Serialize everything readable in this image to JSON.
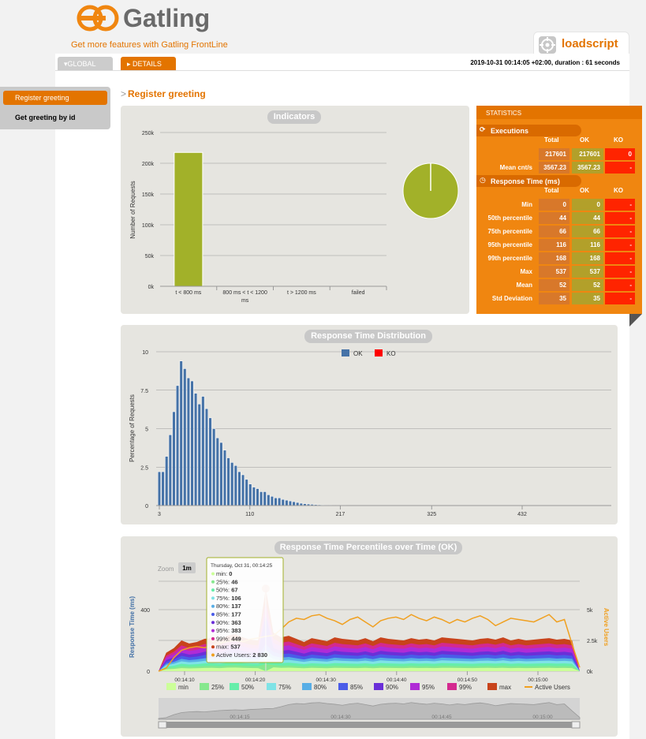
{
  "brand": {
    "name": "Gatling",
    "frontline_link": "Get more features with Gatling FrontLine"
  },
  "simulation": {
    "name": "loadscript"
  },
  "tabs": {
    "global": "GLOBAL",
    "details": "DETAILS"
  },
  "run_info": "2019-10-31 00:14:05 +02:00, duration : 61 seconds",
  "sidebar": {
    "items": [
      {
        "label": "Register greeting"
      },
      {
        "label": "Get greeting by id"
      }
    ]
  },
  "page_title": "Register greeting",
  "indicators": {
    "title": "Indicators",
    "chart_data": {
      "type": "bar",
      "categories": [
        "t < 800 ms",
        "800 ms < t < 1200 ms",
        "t > 1200 ms",
        "failed"
      ],
      "values": [
        217601,
        0,
        0,
        0
      ],
      "ylabel": "Number of Requests",
      "yticks": [
        "0k",
        "50k",
        "100k",
        "150k",
        "200k",
        "250k"
      ],
      "ylim": [
        0,
        250000
      ],
      "colors": [
        "#a2b129"
      ]
    },
    "pie": {
      "values": [
        217601,
        0
      ],
      "colors": [
        "#a2b129",
        "#ff0000"
      ]
    }
  },
  "statistics": {
    "title": "STATISTICS",
    "executions": {
      "title": "Executions",
      "headers": [
        "Total",
        "OK",
        "KO"
      ],
      "rows": [
        {
          "label": "",
          "total": "217601",
          "ok": "217601",
          "ko": "0"
        },
        {
          "label": "Mean cnt/s",
          "total": "3567.23",
          "ok": "3567.23",
          "ko": "-"
        }
      ]
    },
    "response_time": {
      "title": "Response Time (ms)",
      "headers": [
        "Total",
        "OK",
        "KO"
      ],
      "rows": [
        {
          "label": "Min",
          "total": "0",
          "ok": "0",
          "ko": "-"
        },
        {
          "label": "50th percentile",
          "total": "44",
          "ok": "44",
          "ko": "-"
        },
        {
          "label": "75th percentile",
          "total": "66",
          "ok": "66",
          "ko": "-"
        },
        {
          "label": "95th percentile",
          "total": "116",
          "ok": "116",
          "ko": "-"
        },
        {
          "label": "99th percentile",
          "total": "168",
          "ok": "168",
          "ko": "-"
        },
        {
          "label": "Max",
          "total": "537",
          "ok": "537",
          "ko": "-"
        },
        {
          "label": "Mean",
          "total": "52",
          "ok": "52",
          "ko": "-"
        },
        {
          "label": "Std Deviation",
          "total": "35",
          "ok": "35",
          "ko": "-"
        }
      ]
    }
  },
  "distribution": {
    "title": "Response Time Distribution",
    "chart_data": {
      "type": "bar",
      "ylabel": "Percentage of Requests",
      "yticks": [
        "0",
        "2.5",
        "5",
        "7.5",
        "10"
      ],
      "ylim": [
        0,
        10
      ],
      "xticks": [
        "3",
        "110",
        "217",
        "325",
        "432"
      ],
      "xlim": [
        3,
        540
      ],
      "legend": [
        {
          "name": "OK",
          "color": "#4572a7"
        },
        {
          "name": "KO",
          "color": "#ff0000"
        }
      ],
      "bin_width": 4.3,
      "x": [
        3,
        7.3,
        11.6,
        15.9,
        20.2,
        24.5,
        28.8,
        33.1,
        37.4,
        41.7,
        46,
        50.3,
        54.6,
        58.9,
        63.2,
        67.5,
        71.8,
        76.1,
        80.4,
        84.7,
        89,
        93.3,
        97.6,
        101.9,
        106.2,
        110.5,
        114.8,
        119.1,
        123.4,
        127.7,
        132,
        136.3,
        140.6,
        144.9,
        149.2,
        153.5,
        157.8,
        162.1,
        166.4,
        170.7,
        175,
        179.3,
        183.6,
        187.9,
        192.2,
        196.5,
        200.8,
        205.1,
        209.4,
        213.7,
        218,
        222.3
      ],
      "values": [
        2.2,
        2.2,
        3.2,
        4.6,
        6.1,
        7.8,
        9.4,
        8.9,
        8.3,
        8.1,
        7.3,
        6.6,
        7.1,
        6.3,
        5.7,
        5,
        4.4,
        4.1,
        3.6,
        3.1,
        2.8,
        2.6,
        2.2,
        2,
        1.7,
        1.4,
        1.2,
        1.1,
        0.9,
        0.9,
        0.7,
        0.6,
        0.5,
        0.5,
        0.4,
        0.35,
        0.3,
        0.25,
        0.2,
        0.15,
        0.12,
        0.1,
        0.08,
        0.06,
        0.05,
        0.04,
        0.03,
        0.03,
        0.02,
        0.02,
        0.02,
        0.02
      ]
    }
  },
  "percentiles": {
    "title": "Response Time Percentiles over Time (OK)",
    "zoom_label": "Zoom",
    "zoom_option": "1m",
    "chart_data": {
      "type": "area",
      "ylabel": "Response Time (ms)",
      "y2label": "Active Users",
      "yticks": [
        "0",
        "200",
        "400"
      ],
      "y2ticks": [
        "0k",
        "2.5k",
        "5k"
      ],
      "xticks": [
        "00:14:10",
        "00:14:20",
        "00:14:30",
        "00:14:40",
        "00:14:50",
        "00:15:00"
      ],
      "navigator_ticks": [
        "00:14:15",
        "00:14:30",
        "00:14:45",
        "00:15:00"
      ],
      "series": [
        {
          "name": "min",
          "color": "#ccff99"
        },
        {
          "name": "25%",
          "color": "#86e88e"
        },
        {
          "name": "50%",
          "color": "#66eeaa"
        },
        {
          "name": "75%",
          "color": "#7fe3e6"
        },
        {
          "name": "80%",
          "color": "#58aee6"
        },
        {
          "name": "85%",
          "color": "#4a5ce8"
        },
        {
          "name": "90%",
          "color": "#6a2fd8"
        },
        {
          "name": "95%",
          "color": "#b02bd6"
        },
        {
          "name": "99%",
          "color": "#d4298f"
        },
        {
          "name": "max",
          "color": "#c8431b"
        },
        {
          "name": "Active Users",
          "color": "#f0a020"
        }
      ],
      "max_values": [
        0,
        120,
        150,
        200,
        180,
        190,
        210,
        215,
        200,
        230,
        240,
        220,
        205,
        200,
        537,
        250,
        220,
        230,
        210,
        190,
        215,
        205,
        195,
        220,
        210,
        205,
        200,
        215,
        195,
        220,
        210,
        205,
        200,
        215,
        205,
        210,
        200,
        220,
        215,
        210,
        205,
        200,
        210,
        215,
        205,
        220,
        200,
        210,
        200,
        205,
        210,
        215,
        205,
        210,
        200,
        0
      ],
      "users_values": [
        0,
        250,
        1100,
        1700,
        1900,
        2000,
        1900,
        2100,
        2300,
        2400,
        2500,
        2400,
        2600,
        2700,
        2830,
        2900,
        3400,
        4000,
        4300,
        4200,
        4500,
        4600,
        4300,
        4100,
        3800,
        4200,
        4400,
        4000,
        3600,
        4100,
        4300,
        4400,
        4200,
        4600,
        4300,
        4100,
        4400,
        4200,
        3900,
        4200,
        4000,
        4300,
        4500,
        4200,
        3700,
        4000,
        4300,
        4200,
        4100,
        4000,
        4300,
        4600,
        4000,
        4200,
        2200,
        300
      ]
    },
    "tooltip": {
      "title": "Thursday, Oct 31, 00:14:25",
      "rows": [
        {
          "label": "min",
          "value": "0",
          "color": "#ccff99"
        },
        {
          "label": "25%",
          "value": "46",
          "color": "#86e88e"
        },
        {
          "label": "50%",
          "value": "67",
          "color": "#66eeaa"
        },
        {
          "label": "75%",
          "value": "106",
          "color": "#7fe3e6"
        },
        {
          "label": "80%",
          "value": "137",
          "color": "#58aee6"
        },
        {
          "label": "85%",
          "value": "177",
          "color": "#4a5ce8"
        },
        {
          "label": "90%",
          "value": "363",
          "color": "#6a2fd8"
        },
        {
          "label": "95%",
          "value": "383",
          "color": "#b02bd6"
        },
        {
          "label": "99%",
          "value": "449",
          "color": "#d4298f"
        },
        {
          "label": "max",
          "value": "537",
          "color": "#c8431b"
        },
        {
          "label": "Active Users",
          "value": "2 830",
          "color": "#f0a020"
        }
      ]
    }
  }
}
